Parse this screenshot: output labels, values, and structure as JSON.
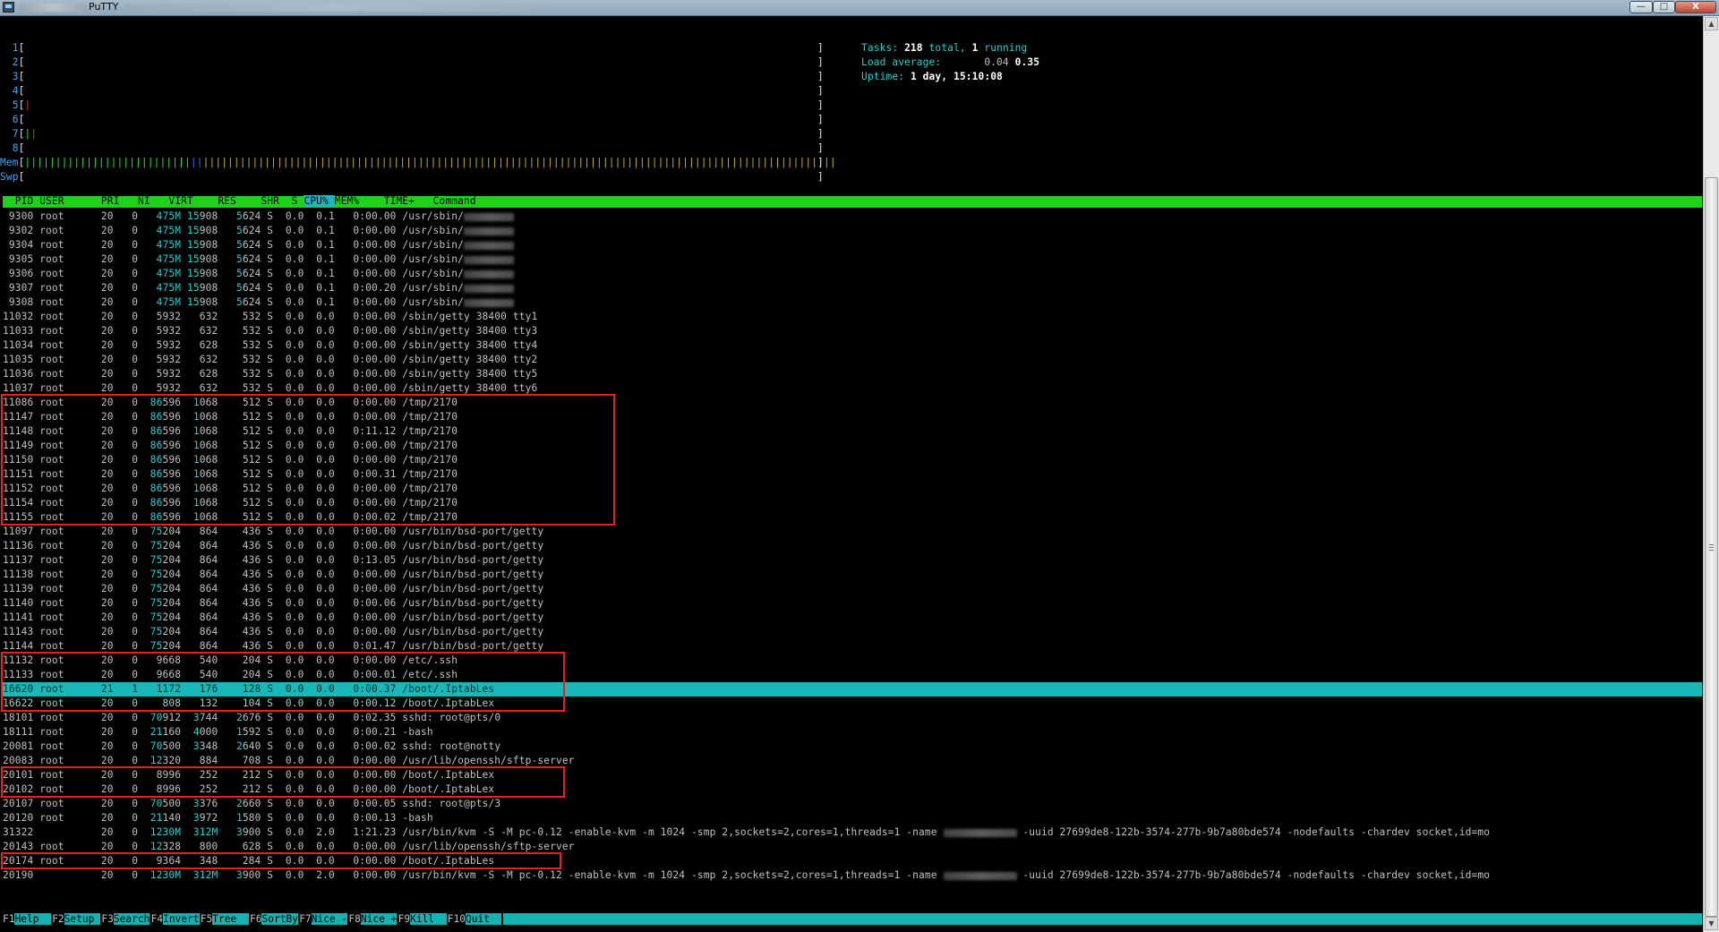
{
  "window": {
    "title": "PuTTY",
    "icons": {
      "app": "putty-icon",
      "minimize": "minimize-icon",
      "maximize": "maximize-icon",
      "close": "close-icon"
    },
    "buttons": {
      "minimize": "—",
      "maximize": "□",
      "close": "X"
    }
  },
  "meters": [
    {
      "label": "1",
      "bars": [],
      "level": 0.0
    },
    {
      "label": "2",
      "bars": [],
      "level": 0.0
    },
    {
      "label": "3",
      "bars": [],
      "level": 0.0
    },
    {
      "label": "4",
      "bars": [],
      "level": 0.0
    },
    {
      "label": "5",
      "bars": [
        {
          "ch": "|",
          "color": "red"
        }
      ],
      "level": 0.01
    },
    {
      "label": "6",
      "bars": [],
      "level": 0.0
    },
    {
      "label": "7",
      "bars": [
        {
          "ch": "|",
          "color": "grn"
        },
        {
          "ch": "|",
          "color": "red"
        }
      ],
      "level": 0.02
    },
    {
      "label": "8",
      "bars": [],
      "level": 0.0
    }
  ],
  "mem": {
    "label": "Mem",
    "green": 27,
    "blue": 2,
    "yellow": 103
  },
  "swp": {
    "label": "Swp"
  },
  "bracket_open": "[",
  "bracket_close": "]",
  "stats": {
    "tasks_label": "Tasks: ",
    "tasks_total": "218",
    "tasks_total_suffix": " total, ",
    "tasks_running": "1",
    "tasks_running_suffix": " running",
    "load_label": "Load average: ",
    "load_1": "0.04",
    "load_5": "0.35",
    "uptime_label": "Uptime: ",
    "uptime": "1 day, 15:10:08"
  },
  "columns": [
    "  PID",
    "USER",
    "     PRI",
    "  NI",
    "  VIRT",
    "   RES",
    "   SHR",
    " S",
    "CPU%",
    "MEM%",
    "   TIME+ ",
    " Command"
  ],
  "processes": [
    [
      "9300",
      "root",
      "20",
      "0",
      "475M",
      "15908",
      "5624",
      "S",
      "0.0",
      "0.1",
      "0:00.00",
      "/usr/sbin/",
      true
    ],
    [
      "9302",
      "root",
      "20",
      "0",
      "475M",
      "15908",
      "5624",
      "S",
      "0.0",
      "0.1",
      "0:00.00",
      "/usr/sbin/",
      true
    ],
    [
      "9304",
      "root",
      "20",
      "0",
      "475M",
      "15908",
      "5624",
      "S",
      "0.0",
      "0.1",
      "0:00.00",
      "/usr/sbin/",
      true
    ],
    [
      "9305",
      "root",
      "20",
      "0",
      "475M",
      "15908",
      "5624",
      "S",
      "0.0",
      "0.1",
      "0:00.00",
      "/usr/sbin/",
      true
    ],
    [
      "9306",
      "root",
      "20",
      "0",
      "475M",
      "15908",
      "5624",
      "S",
      "0.0",
      "0.1",
      "0:00.00",
      "/usr/sbin/",
      true
    ],
    [
      "9307",
      "root",
      "20",
      "0",
      "475M",
      "15908",
      "5624",
      "S",
      "0.0",
      "0.1",
      "0:00.20",
      "/usr/sbin/",
      true
    ],
    [
      "9308",
      "root",
      "20",
      "0",
      "475M",
      "15908",
      "5624",
      "S",
      "0.0",
      "0.1",
      "0:00.00",
      "/usr/sbin/",
      true
    ],
    [
      "11032",
      "root",
      "20",
      "0",
      "5932",
      "632",
      "532",
      "S",
      "0.0",
      "0.0",
      "0:00.00",
      "/sbin/getty 38400 tty1",
      false
    ],
    [
      "11033",
      "root",
      "20",
      "0",
      "5932",
      "632",
      "532",
      "S",
      "0.0",
      "0.0",
      "0:00.00",
      "/sbin/getty 38400 tty3",
      false
    ],
    [
      "11034",
      "root",
      "20",
      "0",
      "5932",
      "628",
      "532",
      "S",
      "0.0",
      "0.0",
      "0:00.00",
      "/sbin/getty 38400 tty4",
      false
    ],
    [
      "11035",
      "root",
      "20",
      "0",
      "5932",
      "632",
      "532",
      "S",
      "0.0",
      "0.0",
      "0:00.00",
      "/sbin/getty 38400 tty2",
      false
    ],
    [
      "11036",
      "root",
      "20",
      "0",
      "5932",
      "628",
      "532",
      "S",
      "0.0",
      "0.0",
      "0:00.00",
      "/sbin/getty 38400 tty5",
      false
    ],
    [
      "11037",
      "root",
      "20",
      "0",
      "5932",
      "632",
      "532",
      "S",
      "0.0",
      "0.0",
      "0:00.00",
      "/sbin/getty 38400 tty6",
      false
    ],
    [
      "11086",
      "root",
      "20",
      "0",
      "86596",
      "1068",
      "512",
      "S",
      "0.0",
      "0.0",
      "0:00.00",
      "/tmp/2170",
      false
    ],
    [
      "11147",
      "root",
      "20",
      "0",
      "86596",
      "1068",
      "512",
      "S",
      "0.0",
      "0.0",
      "0:00.00",
      "/tmp/2170",
      false
    ],
    [
      "11148",
      "root",
      "20",
      "0",
      "86596",
      "1068",
      "512",
      "S",
      "0.0",
      "0.0",
      "0:11.12",
      "/tmp/2170",
      false
    ],
    [
      "11149",
      "root",
      "20",
      "0",
      "86596",
      "1068",
      "512",
      "S",
      "0.0",
      "0.0",
      "0:00.00",
      "/tmp/2170",
      false
    ],
    [
      "11150",
      "root",
      "20",
      "0",
      "86596",
      "1068",
      "512",
      "S",
      "0.0",
      "0.0",
      "0:00.00",
      "/tmp/2170",
      false
    ],
    [
      "11151",
      "root",
      "20",
      "0",
      "86596",
      "1068",
      "512",
      "S",
      "0.0",
      "0.0",
      "0:00.31",
      "/tmp/2170",
      false
    ],
    [
      "11152",
      "root",
      "20",
      "0",
      "86596",
      "1068",
      "512",
      "S",
      "0.0",
      "0.0",
      "0:00.00",
      "/tmp/2170",
      false
    ],
    [
      "11154",
      "root",
      "20",
      "0",
      "86596",
      "1068",
      "512",
      "S",
      "0.0",
      "0.0",
      "0:00.00",
      "/tmp/2170",
      false
    ],
    [
      "11155",
      "root",
      "20",
      "0",
      "86596",
      "1068",
      "512",
      "S",
      "0.0",
      "0.0",
      "0:00.02",
      "/tmp/2170",
      false
    ],
    [
      "11097",
      "root",
      "20",
      "0",
      "75204",
      "864",
      "436",
      "S",
      "0.0",
      "0.0",
      "0:00.00",
      "/usr/bin/bsd-port/getty",
      false
    ],
    [
      "11136",
      "root",
      "20",
      "0",
      "75204",
      "864",
      "436",
      "S",
      "0.0",
      "0.0",
      "0:00.00",
      "/usr/bin/bsd-port/getty",
      false
    ],
    [
      "11137",
      "root",
      "20",
      "0",
      "75204",
      "864",
      "436",
      "S",
      "0.0",
      "0.0",
      "0:13.05",
      "/usr/bin/bsd-port/getty",
      false
    ],
    [
      "11138",
      "root",
      "20",
      "0",
      "75204",
      "864",
      "436",
      "S",
      "0.0",
      "0.0",
      "0:00.00",
      "/usr/bin/bsd-port/getty",
      false
    ],
    [
      "11139",
      "root",
      "20",
      "0",
      "75204",
      "864",
      "436",
      "S",
      "0.0",
      "0.0",
      "0:00.00",
      "/usr/bin/bsd-port/getty",
      false
    ],
    [
      "11140",
      "root",
      "20",
      "0",
      "75204",
      "864",
      "436",
      "S",
      "0.0",
      "0.0",
      "0:00.06",
      "/usr/bin/bsd-port/getty",
      false
    ],
    [
      "11141",
      "root",
      "20",
      "0",
      "75204",
      "864",
      "436",
      "S",
      "0.0",
      "0.0",
      "0:00.00",
      "/usr/bin/bsd-port/getty",
      false
    ],
    [
      "11143",
      "root",
      "20",
      "0",
      "75204",
      "864",
      "436",
      "S",
      "0.0",
      "0.0",
      "0:00.00",
      "/usr/bin/bsd-port/getty",
      false
    ],
    [
      "11144",
      "root",
      "20",
      "0",
      "75204",
      "864",
      "436",
      "S",
      "0.0",
      "0.0",
      "0:01.47",
      "/usr/bin/bsd-port/getty",
      false
    ],
    [
      "11132",
      "root",
      "20",
      "0",
      "9668",
      "540",
      "204",
      "S",
      "0.0",
      "0.0",
      "0:00.00",
      "/etc/.ssh",
      false
    ],
    [
      "11133",
      "root",
      "20",
      "0",
      "9668",
      "540",
      "204",
      "S",
      "0.0",
      "0.0",
      "0:00.01",
      "/etc/.ssh",
      false
    ],
    [
      "16620",
      "root",
      "21",
      "1",
      "1172",
      "176",
      "128",
      "S",
      "0.0",
      "0.0",
      "0:00.37",
      "/boot/.IptabLes",
      false
    ],
    [
      "16622",
      "root",
      "20",
      "0",
      "808",
      "132",
      "104",
      "S",
      "0.0",
      "0.0",
      "0:00.12",
      "/boot/.IptabLex",
      false
    ],
    [
      "18101",
      "root",
      "20",
      "0",
      "70912",
      "3744",
      "2676",
      "S",
      "0.0",
      "0.0",
      "0:02.35",
      "sshd: root@pts/0",
      false
    ],
    [
      "18111",
      "root",
      "20",
      "0",
      "21160",
      "4000",
      "1592",
      "S",
      "0.0",
      "0.0",
      "0:00.21",
      "-bash",
      false
    ],
    [
      "20081",
      "root",
      "20",
      "0",
      "70500",
      "3348",
      "2640",
      "S",
      "0.0",
      "0.0",
      "0:00.02",
      "sshd: root@notty",
      false
    ],
    [
      "20083",
      "root",
      "20",
      "0",
      "12320",
      "884",
      "708",
      "S",
      "0.0",
      "0.0",
      "0:00.00",
      "/usr/lib/openssh/sftp-server",
      false
    ],
    [
      "20101",
      "root",
      "20",
      "0",
      "8996",
      "252",
      "212",
      "S",
      "0.0",
      "0.0",
      "0:00.00",
      "/boot/.IptabLex",
      false
    ],
    [
      "20102",
      "root",
      "20",
      "0",
      "8996",
      "252",
      "212",
      "S",
      "0.0",
      "0.0",
      "0:00.00",
      "/boot/.IptabLex",
      false
    ],
    [
      "20107",
      "root",
      "20",
      "0",
      "70500",
      "3376",
      "2660",
      "S",
      "0.0",
      "0.0",
      "0:00.05",
      "sshd: root@pts/3",
      false
    ],
    [
      "20120",
      "root",
      "20",
      "0",
      "21140",
      "3972",
      "1580",
      "S",
      "0.0",
      "0.0",
      "0:00.13",
      "-bash",
      false
    ],
    [
      "31322",
      "",
      "20",
      "0",
      "1230M",
      "312M",
      "3900",
      "S",
      "0.0",
      "2.0",
      "1:21.23",
      "/usr/bin/kvm -S -M pc-0.12 -enable-kvm -m 1024 -smp 2,sockets=2,cores=1,threads=1 -name ",
      true
    ],
    [
      "20143",
      "root",
      "20",
      "0",
      "12328",
      "800",
      "628",
      "S",
      "0.0",
      "0.0",
      "0:00.00",
      "/usr/lib/openssh/sftp-server",
      false
    ],
    [
      "20174",
      "root",
      "20",
      "0",
      "9364",
      "348",
      "284",
      "S",
      "0.0",
      "0.0",
      "0:00.00",
      "/boot/.IptabLes",
      false
    ],
    [
      "20190",
      "",
      "20",
      "0",
      "1230M",
      "312M",
      "3900",
      "S",
      "0.0",
      "2.0",
      "0:00.00",
      "/usr/bin/kvm -S -M pc-0.12 -enable-kvm -m 1024 -smp 2,sockets=2,cores=1,threads=1 -name ",
      true
    ]
  ],
  "kvm_tail": " -uuid 27699de8-122b-3574-277b-9b7a80bde574 -nodefaults -chardev socket,id=mo",
  "selected_pid": "16620",
  "footer": [
    {
      "key": "F1",
      "label": "Help  "
    },
    {
      "key": "F2",
      "label": "Setup "
    },
    {
      "key": "F3",
      "label": "Search"
    },
    {
      "key": "F4",
      "label": "Invert"
    },
    {
      "key": "F5",
      "label": "Tree  "
    },
    {
      "key": "F6",
      "label": "SortBy"
    },
    {
      "key": "F7",
      "label": "Nice -"
    },
    {
      "key": "F8",
      "label": "Nice +"
    },
    {
      "key": "F9",
      "label": "Kill  "
    },
    {
      "key": "F10",
      "label": "Quit  "
    }
  ],
  "scrollbar": {
    "up": "▲",
    "down": "▼",
    "up_icon": "scroll-up-icon",
    "down_icon": "scroll-down-icon"
  }
}
